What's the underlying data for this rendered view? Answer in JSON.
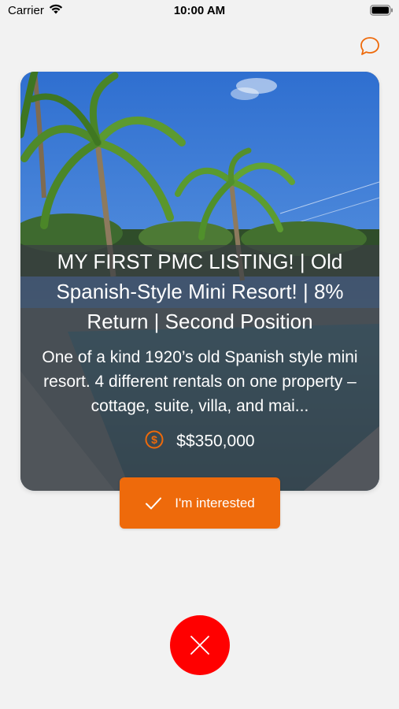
{
  "status_bar": {
    "carrier": "Carrier",
    "time": "10:00 AM"
  },
  "listing": {
    "title": "MY FIRST PMC LISTING! | Old Spanish-Style Mini Resort! | 8% Return | Second Position",
    "description": "One of a kind 1920’s old Spanish style mini resort. 4 different rentals on one property – cottage, suite, villa, and mai...",
    "price": "$$350,000",
    "image_alt": "palm-trees-and-pool-photo"
  },
  "actions": {
    "interested_label": "I'm interested"
  },
  "icons": {
    "chat": "chat-bubble-icon",
    "price": "dollar-circle-icon",
    "interested": "checkmark-icon",
    "dismiss": "close-icon"
  },
  "colors": {
    "accent": "#ee6a0b",
    "dismiss": "#ff0000",
    "background": "#f2f2f2"
  }
}
